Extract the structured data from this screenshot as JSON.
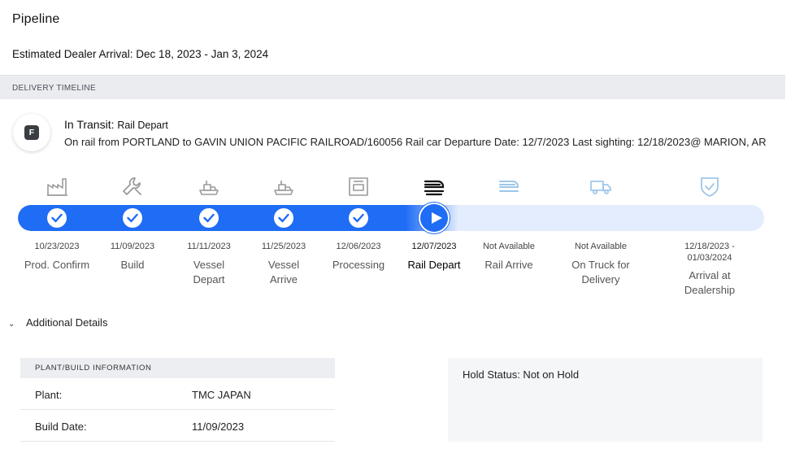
{
  "page": {
    "title": "Pipeline",
    "eta": "Estimated Dealer Arrival: Dec 18, 2023 - Jan 3, 2024"
  },
  "section": {
    "title": "DELIVERY TIMELINE"
  },
  "status": {
    "badge": "F",
    "label": "In Transit:",
    "value": "Rail Depart",
    "description": "On rail from PORTLAND to GAVIN UNION PACIFIC RAILROAD/160056 Rail car Departure Date: 12/7/2023 Last sighting: 12/18/2023@ MARION, AR"
  },
  "timeline": {
    "progress_percent": 59,
    "colors": {
      "complete": "#1f6cf5",
      "pending_track": "#e4edfd",
      "pending_icon": "#9ec7ea",
      "done_icon": "#9a9a9a"
    },
    "stages": [
      {
        "date": "10/23/2023",
        "name": "Prod. Confirm",
        "icon": "factory-icon",
        "state": "done"
      },
      {
        "date": "11/09/2023",
        "name": "Build",
        "icon": "wrench-icon",
        "state": "done"
      },
      {
        "date": "11/11/2023",
        "name": "Vessel Depart",
        "icon": "ship-icon",
        "state": "done"
      },
      {
        "date": "11/25/2023",
        "name": "Vessel Arrive",
        "icon": "ship-icon",
        "state": "done"
      },
      {
        "date": "12/06/2023",
        "name": "Processing",
        "icon": "processing-icon",
        "state": "done"
      },
      {
        "date": "12/07/2023",
        "name": "Rail Depart",
        "icon": "train-icon",
        "state": "current"
      },
      {
        "date": "Not Available",
        "name": "Rail Arrive",
        "icon": "train-icon",
        "state": "pending"
      },
      {
        "date": "Not Available",
        "name": "On Truck for Delivery",
        "icon": "truck-icon",
        "state": "pending"
      },
      {
        "date": "12/18/2023 - 01/03/2024",
        "name": "Arrival at Dealership",
        "icon": "shield-check-icon",
        "state": "pending"
      }
    ]
  },
  "additional": {
    "label": "Additional Details",
    "chevron": "chevron-down-icon"
  },
  "plant_info": {
    "title": "PLANT/BUILD INFORMATION",
    "rows": [
      {
        "key": "Plant:",
        "value": "TMC JAPAN"
      },
      {
        "key": "Build Date:",
        "value": "11/09/2023"
      }
    ]
  },
  "hold": {
    "text": "Hold Status: Not on Hold"
  }
}
